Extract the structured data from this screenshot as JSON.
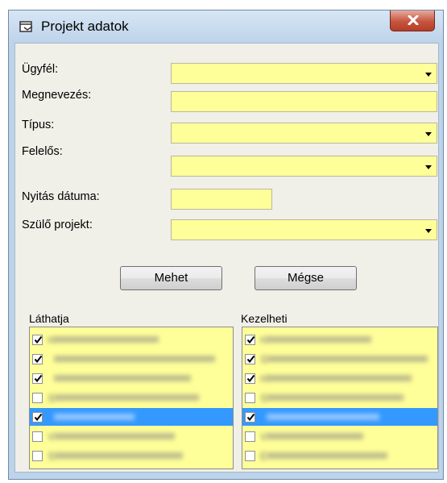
{
  "window": {
    "title": "Projekt adatok"
  },
  "form": {
    "client_label": "Ügyfél:",
    "name_label": "Megnevezés:",
    "type_label": "Típus:",
    "owner_label": "Felelős:",
    "open_date_label": "Nyitás dátuma:",
    "parent_label": "Szülő projekt:"
  },
  "buttons": {
    "go": "Mehet",
    "cancel": "Mégse"
  },
  "lists": {
    "view_label": "Láthatja",
    "manage_label": "Kezelheti",
    "view_items": [
      {
        "checked": true,
        "selected": false,
        "text": "H"
      },
      {
        "checked": true,
        "selected": false,
        "text": ""
      },
      {
        "checked": true,
        "selected": false,
        "text": ""
      },
      {
        "checked": false,
        "selected": false,
        "text": "S"
      },
      {
        "checked": true,
        "selected": true,
        "text": ""
      },
      {
        "checked": false,
        "selected": false,
        "text": "V"
      },
      {
        "checked": false,
        "selected": false,
        "text": "S"
      }
    ],
    "manage_items": [
      {
        "checked": true,
        "selected": false,
        "text": "H"
      },
      {
        "checked": true,
        "selected": false,
        "text": "S"
      },
      {
        "checked": true,
        "selected": false,
        "text": "H"
      },
      {
        "checked": false,
        "selected": false,
        "text": "S"
      },
      {
        "checked": true,
        "selected": true,
        "text": ""
      },
      {
        "checked": false,
        "selected": false,
        "text": "V"
      },
      {
        "checked": false,
        "selected": false,
        "text": "E"
      }
    ]
  },
  "colors": {
    "field_bg": "#ffff99",
    "selection": "#3399ff",
    "close_button": "#c5553f"
  }
}
